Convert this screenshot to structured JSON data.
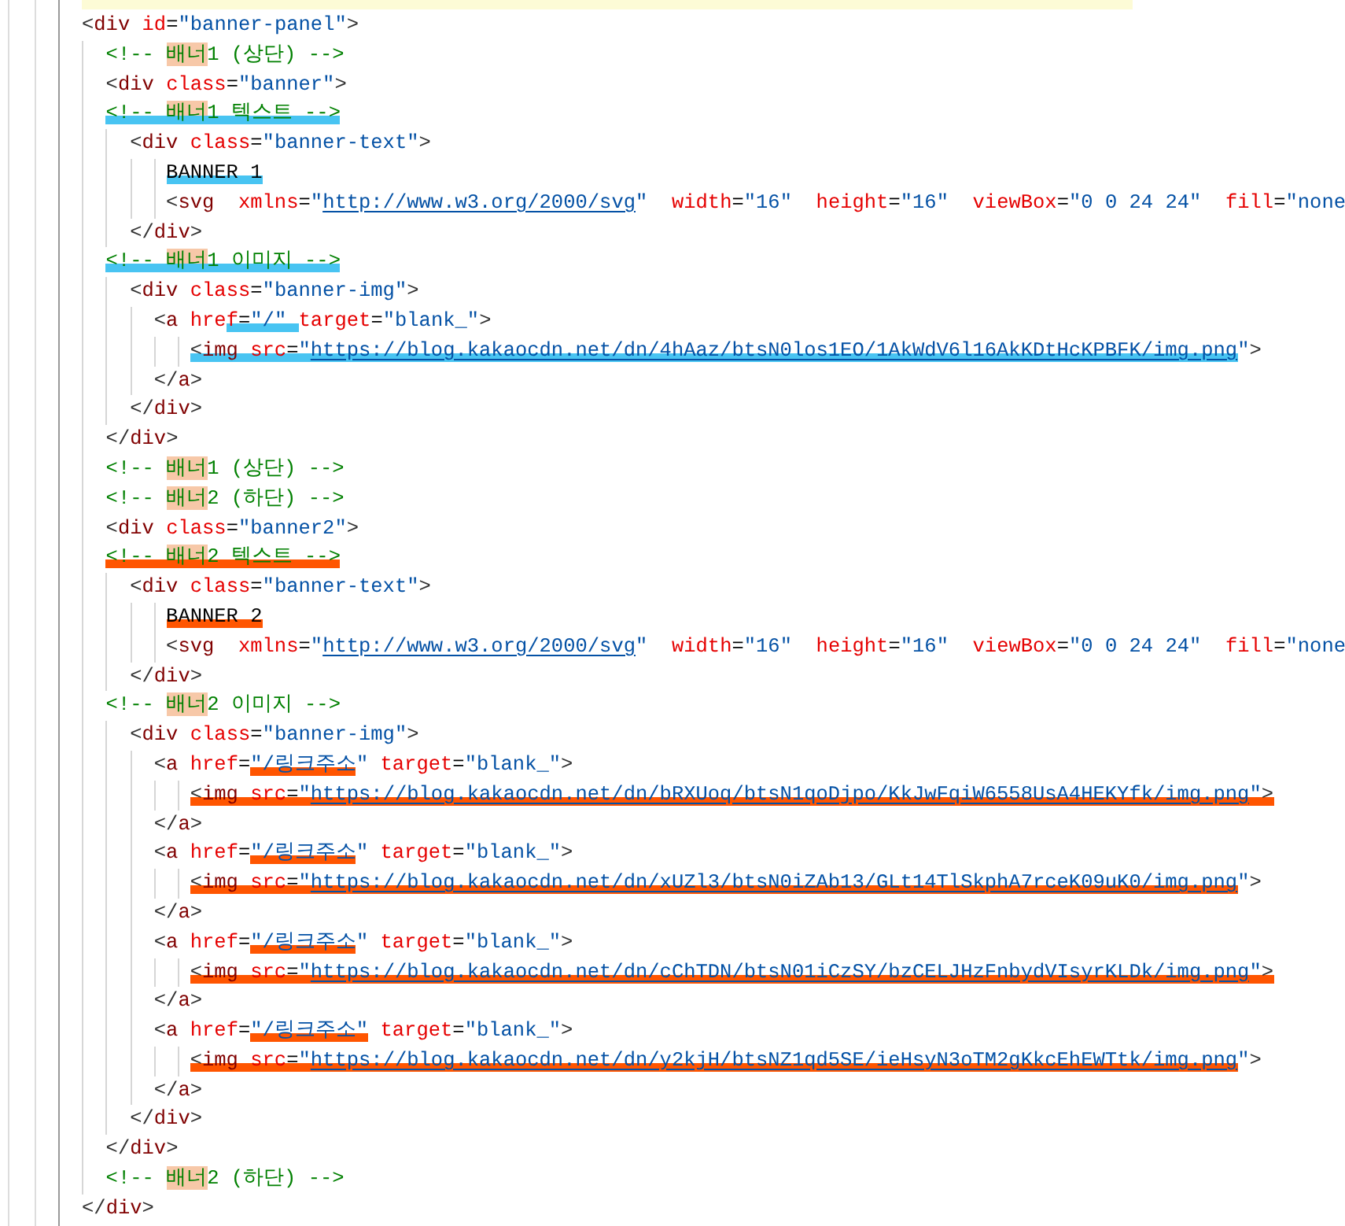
{
  "editor": {
    "lines": [
      {
        "kind": "code",
        "segments": [
          {
            "kind": "text",
            "text": "<div id=\"banner-panel\">"
          }
        ]
      },
      {
        "kind": "comment",
        "segments": [
          {
            "kind": "text",
            "text": "  <!-- "
          },
          {
            "kind": "match",
            "text": "배너"
          },
          {
            "kind": "text",
            "text": "1 (상단) -->"
          }
        ]
      },
      {
        "kind": "code",
        "segments": [
          {
            "kind": "text",
            "text": "  <div class=\"banner\">"
          }
        ]
      },
      {
        "kind": "comment",
        "segments": [
          {
            "kind": "text",
            "text": "  <!-- ",
            "color": "#48c4f2"
          },
          {
            "kind": "match",
            "text": "배너",
            "color": "#48c4f2"
          },
          {
            "kind": "text",
            "text": "1 텍스트 -->",
            "color": "#48c4f2"
          }
        ]
      },
      {
        "kind": "code",
        "segments": [
          {
            "kind": "text",
            "text": "    <div class=\"banner-text\">"
          }
        ]
      },
      {
        "kind": "code",
        "segments": [
          {
            "kind": "text",
            "text": "       BANNER 1",
            "color": "#48c4f2"
          }
        ]
      },
      {
        "kind": "code",
        "segments": [
          {
            "kind": "text",
            "text": "       <svg  xmlns=\""
          },
          {
            "kind": "link",
            "text": "http://www.w3.org/2000/svg"
          },
          {
            "kind": "text",
            "text": "\"  width=\"16\"  height=\"16\"  viewBox=\"0 0 24 24\"  fill=\"none"
          }
        ]
      },
      {
        "kind": "code",
        "segments": [
          {
            "kind": "text",
            "text": "    </div>"
          }
        ]
      },
      {
        "kind": "comment",
        "segments": [
          {
            "kind": "text",
            "text": "  <!-- ",
            "color": "#48c4f2"
          },
          {
            "kind": "match",
            "text": "배너",
            "color": "#48c4f2"
          },
          {
            "kind": "text",
            "text": "1 이미지 -->",
            "color": "#48c4f2"
          }
        ]
      },
      {
        "kind": "code",
        "segments": [
          {
            "kind": "text",
            "text": "    <div class=\"banner-img\">"
          }
        ]
      },
      {
        "kind": "code",
        "segments": [
          {
            "kind": "text",
            "text": "      <a hre"
          },
          {
            "kind": "text",
            "text": "f=\"/\" ",
            "color": "#48c4f2"
          },
          {
            "kind": "text",
            "text": "target=\"blank_\">"
          }
        ]
      },
      {
        "kind": "code",
        "segments": [
          {
            "kind": "text",
            "text": "         <img src=\"",
            "color": "#48c4f2"
          },
          {
            "kind": "link",
            "text": "https://blog.kakaocdn.net/dn/4hAaz/btsN0los1EO/1AkWdV6l16AkKDtHcKPBFK/img.png",
            "color": "#48c4f2"
          },
          {
            "kind": "text",
            "text": "\">"
          }
        ]
      },
      {
        "kind": "code",
        "segments": [
          {
            "kind": "text",
            "text": "      </a>"
          }
        ]
      },
      {
        "kind": "code",
        "segments": [
          {
            "kind": "text",
            "text": "    </div>"
          }
        ]
      },
      {
        "kind": "code",
        "segments": [
          {
            "kind": "text",
            "text": "  </div>"
          }
        ]
      },
      {
        "kind": "comment",
        "segments": [
          {
            "kind": "text",
            "text": "  <!-- "
          },
          {
            "kind": "match",
            "text": "배너"
          },
          {
            "kind": "text",
            "text": "1 (상단) -->"
          }
        ]
      },
      {
        "kind": "comment",
        "segments": [
          {
            "kind": "text",
            "text": "  <!-- "
          },
          {
            "kind": "match",
            "text": "배너"
          },
          {
            "kind": "text",
            "text": "2 (하단) -->"
          }
        ]
      },
      {
        "kind": "code",
        "segments": [
          {
            "kind": "text",
            "text": "  <div class=\"banner2\">"
          }
        ]
      },
      {
        "kind": "comment",
        "segments": [
          {
            "kind": "text",
            "text": "  <!-- ",
            "color": "#ff5500"
          },
          {
            "kind": "match",
            "text": "배너",
            "color": "#ff5500"
          },
          {
            "kind": "text",
            "text": "2 텍스트 -->",
            "color": "#ff5500"
          }
        ]
      },
      {
        "kind": "code",
        "segments": [
          {
            "kind": "text",
            "text": "    <div class=\"banner-text\">"
          }
        ]
      },
      {
        "kind": "code",
        "segments": [
          {
            "kind": "text",
            "text": "       BANNER 2",
            "color": "#ff5500"
          }
        ]
      },
      {
        "kind": "code",
        "segments": [
          {
            "kind": "text",
            "text": "       <svg  xmlns=\""
          },
          {
            "kind": "link",
            "text": "http://www.w3.org/2000/svg"
          },
          {
            "kind": "text",
            "text": "\"  width=\"16\"  height=\"16\"  viewBox=\"0 0 24 24\"  fill=\"none"
          }
        ]
      },
      {
        "kind": "code",
        "segments": [
          {
            "kind": "text",
            "text": "    </div>"
          }
        ]
      },
      {
        "kind": "comment",
        "segments": [
          {
            "kind": "text",
            "text": "  <!-- "
          },
          {
            "kind": "match",
            "text": "배너"
          },
          {
            "kind": "text",
            "text": "2 이미지 -->"
          }
        ]
      },
      {
        "kind": "code",
        "segments": [
          {
            "kind": "text",
            "text": "    <div class=\"banner-img\">"
          }
        ]
      },
      {
        "kind": "code",
        "segments": [
          {
            "kind": "text",
            "text": "      <a href="
          },
          {
            "kind": "text",
            "text": "\"/링크주소",
            "color": "#ff5500"
          },
          {
            "kind": "text",
            "text": "\" target=\"blank_\">"
          }
        ]
      },
      {
        "kind": "code",
        "segments": [
          {
            "kind": "text",
            "text": "         <img src=\"",
            "color": "#ff5500"
          },
          {
            "kind": "link",
            "text": "https://blog.kakaocdn.net/dn/bRXUoq/btsN1qoDjpo/KkJwFqiW6558UsA4HEKYfk/img.png",
            "color": "#ff5500"
          },
          {
            "kind": "text",
            "text": "\">",
            "color": "#ff5500"
          }
        ]
      },
      {
        "kind": "code",
        "segments": [
          {
            "kind": "text",
            "text": "      </a>"
          }
        ]
      },
      {
        "kind": "code",
        "segments": [
          {
            "kind": "text",
            "text": "      <a href="
          },
          {
            "kind": "text",
            "text": "\"/링크주소",
            "color": "#ff5500"
          },
          {
            "kind": "text",
            "text": "\" target=\"blank_\">"
          }
        ]
      },
      {
        "kind": "code",
        "segments": [
          {
            "kind": "text",
            "text": "         <img src=\"",
            "color": "#ff5500"
          },
          {
            "kind": "link",
            "text": "https://blog.kakaocdn.net/dn/xUZl3/btsN0iZAb13/GLt14TlSkphA7rceK09uK0/img.png",
            "color": "#ff5500"
          },
          {
            "kind": "text",
            "text": "\">"
          }
        ]
      },
      {
        "kind": "code",
        "segments": [
          {
            "kind": "text",
            "text": "      </a>"
          }
        ]
      },
      {
        "kind": "code",
        "segments": [
          {
            "kind": "text",
            "text": "      <a href="
          },
          {
            "kind": "text",
            "text": "\"/링크주소",
            "color": "#ff5500"
          },
          {
            "kind": "text",
            "text": "\" target=\"blank_\">"
          }
        ]
      },
      {
        "kind": "code",
        "segments": [
          {
            "kind": "text",
            "text": "         <img src=\"",
            "color": "#ff5500"
          },
          {
            "kind": "link",
            "text": "https://blog.kakaocdn.net/dn/cChTDN/btsN01iCzSY/bzCELJHzFnbydVIsyrKLDk/img.png",
            "color": "#ff5500"
          },
          {
            "kind": "text",
            "text": "\">",
            "color": "#ff5500"
          }
        ]
      },
      {
        "kind": "code",
        "segments": [
          {
            "kind": "text",
            "text": "      </a>"
          }
        ]
      },
      {
        "kind": "code",
        "segments": [
          {
            "kind": "text",
            "text": "      <a href="
          },
          {
            "kind": "text",
            "text": "\"/링크주소\"",
            "color": "#ff5500"
          },
          {
            "kind": "text",
            "text": " target=\"blank_\">"
          }
        ]
      },
      {
        "kind": "code",
        "segments": [
          {
            "kind": "text",
            "text": "         <img src=\"",
            "color": "#ff5500"
          },
          {
            "kind": "link",
            "text": "https://blog.kakaocdn.net/dn/y2kjH/btsNZ1qd5SE/ieHsyN3oTM2gKkcEhEWTtk/img.png",
            "color": "#ff5500"
          },
          {
            "kind": "text",
            "text": "\">"
          }
        ]
      },
      {
        "kind": "code",
        "segments": [
          {
            "kind": "text",
            "text": "      </a>"
          }
        ]
      },
      {
        "kind": "code",
        "segments": [
          {
            "kind": "text",
            "text": "    </div>"
          }
        ]
      },
      {
        "kind": "code",
        "segments": [
          {
            "kind": "text",
            "text": "  </div>"
          }
        ]
      },
      {
        "kind": "comment",
        "segments": [
          {
            "kind": "text",
            "text": "  <!-- "
          },
          {
            "kind": "match",
            "text": "배너"
          },
          {
            "kind": "text",
            "text": "2 (하단) -->"
          }
        ]
      },
      {
        "kind": "code",
        "segments": [
          {
            "kind": "text",
            "text": "</div>"
          }
        ]
      }
    ]
  }
}
